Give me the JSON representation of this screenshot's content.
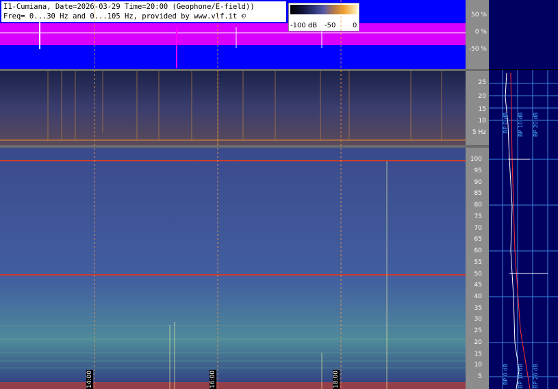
{
  "header": {
    "line1": "I1-Cumiana, Date=2026-03-29 Time=20:00 (Geophone/E-field))",
    "line2": "Freq= 0...30 Hz and 0...105 Hz, provided by www.vlf.it ©"
  },
  "colorbar": {
    "labels": [
      "-100 dB",
      "-50",
      "0"
    ]
  },
  "waveform_axis": {
    "labels": [
      "50 %",
      "0 %",
      "-50 %"
    ]
  },
  "spec1_axis": {
    "labels": [
      "25",
      "20",
      "15",
      "10",
      "5 Hz"
    ]
  },
  "spec2_axis": {
    "labels": [
      "100",
      "95",
      "90",
      "85",
      "80",
      "75",
      "70",
      "65",
      "60",
      "55",
      "50",
      "45",
      "40",
      "35",
      "30",
      "25",
      "20",
      "15",
      "10",
      "5"
    ]
  },
  "time_markers": [
    "14:00",
    "16:00",
    "18:00"
  ],
  "profile_top": {
    "labels": [
      "BP 0 dB",
      "BP 10 dB",
      "BP 20 dB"
    ]
  },
  "profile_bottom": {
    "labels": [
      "BP 0 dB",
      "BP 10 dB",
      "BP 20 dB"
    ]
  },
  "colors": {
    "wave_bg": "#0000ff",
    "wave_signal": "#ff00ff",
    "axis_gray": "#8c8c8c",
    "profile_bg": "#000060",
    "grid": "#4aa8ff",
    "marker": "#ff8800"
  }
}
